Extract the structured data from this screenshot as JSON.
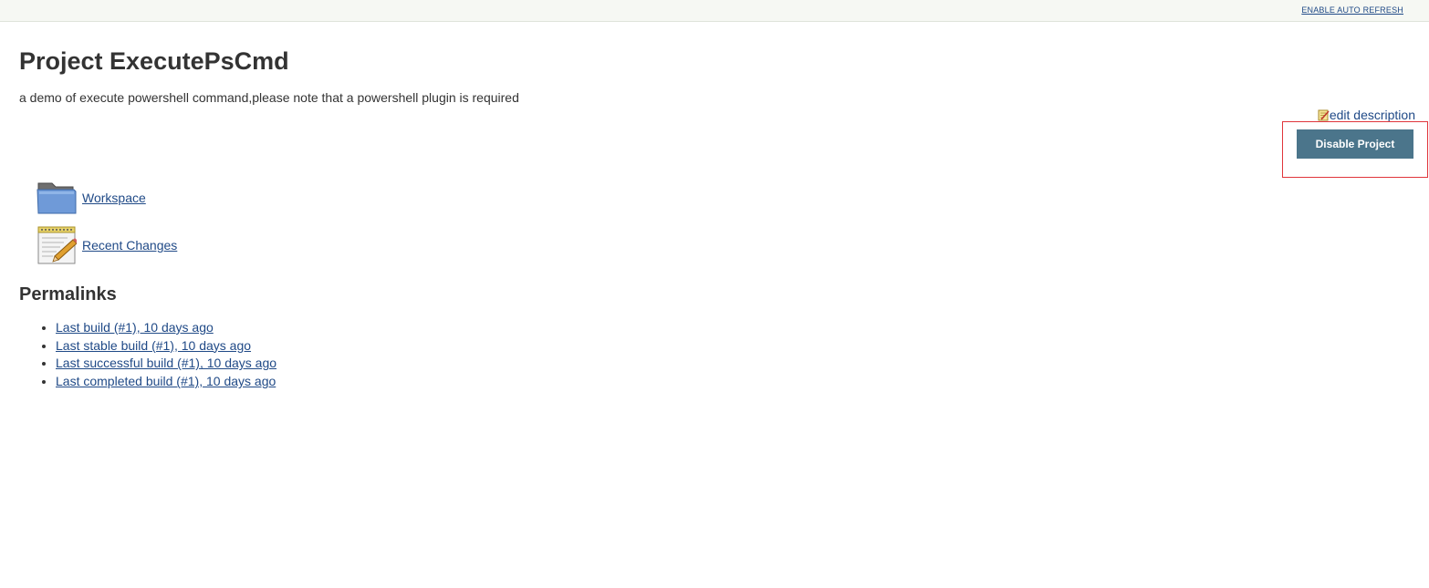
{
  "topbar": {
    "auto_refresh_label": "ENABLE AUTO REFRESH"
  },
  "project": {
    "title": "Project ExecutePsCmd",
    "description": "a demo of execute powershell command,please note that a powershell plugin is required",
    "edit_description_label": "edit description",
    "disable_button_label": "Disable Project"
  },
  "tasks": [
    {
      "label": "Workspace",
      "icon": "folder-icon"
    },
    {
      "label": "Recent Changes",
      "icon": "notepad-icon"
    }
  ],
  "permalinks": {
    "title": "Permalinks",
    "items": [
      {
        "label": "Last build (#1), 10 days ago"
      },
      {
        "label": "Last stable build (#1), 10 days ago"
      },
      {
        "label": "Last successful build (#1), 10 days ago"
      },
      {
        "label": "Last completed build (#1), 10 days ago"
      }
    ]
  },
  "colors": {
    "link": "#204a87",
    "button": "#4b758b",
    "highlight": "#e0353b",
    "topbar": "#f6f8f3"
  }
}
